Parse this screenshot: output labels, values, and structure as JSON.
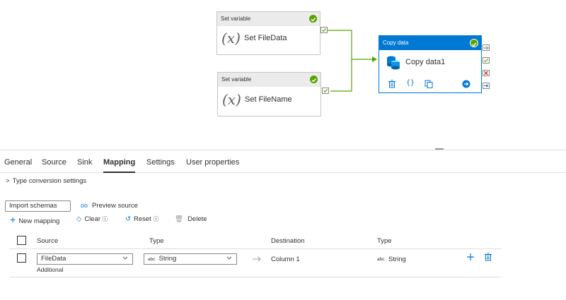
{
  "pipeline": {
    "activity1": {
      "type_label": "Set variable",
      "name": "Set FileData"
    },
    "activity2": {
      "type_label": "Set variable",
      "name": "Set FileName"
    },
    "activity3": {
      "type_label": "Copy data",
      "name": "Copy data1"
    }
  },
  "tabs": [
    "General",
    "Source",
    "Sink",
    "Mapping",
    "Settings",
    "User properties"
  ],
  "active_tab": "Mapping",
  "type_conversion": "Type conversion settings",
  "toolbar": {
    "import_schemas": "Import schemas",
    "preview_source": "Preview source",
    "new_mapping": "New mapping",
    "clear": "Clear",
    "reset": "Reset",
    "delete": "Delete"
  },
  "table": {
    "headers": [
      "Source",
      "Type",
      "Destination",
      "Type"
    ],
    "row": {
      "source": "FileData",
      "source_sub": "Additional",
      "type_badge": "abc",
      "type": "String",
      "destination": "Column 1",
      "dest_type_badge": "abc",
      "dest_type": "String"
    }
  },
  "colors": {
    "accent": "#0078d4",
    "success": "#57a300",
    "failure": "#d13438",
    "connector": "#57a300"
  }
}
